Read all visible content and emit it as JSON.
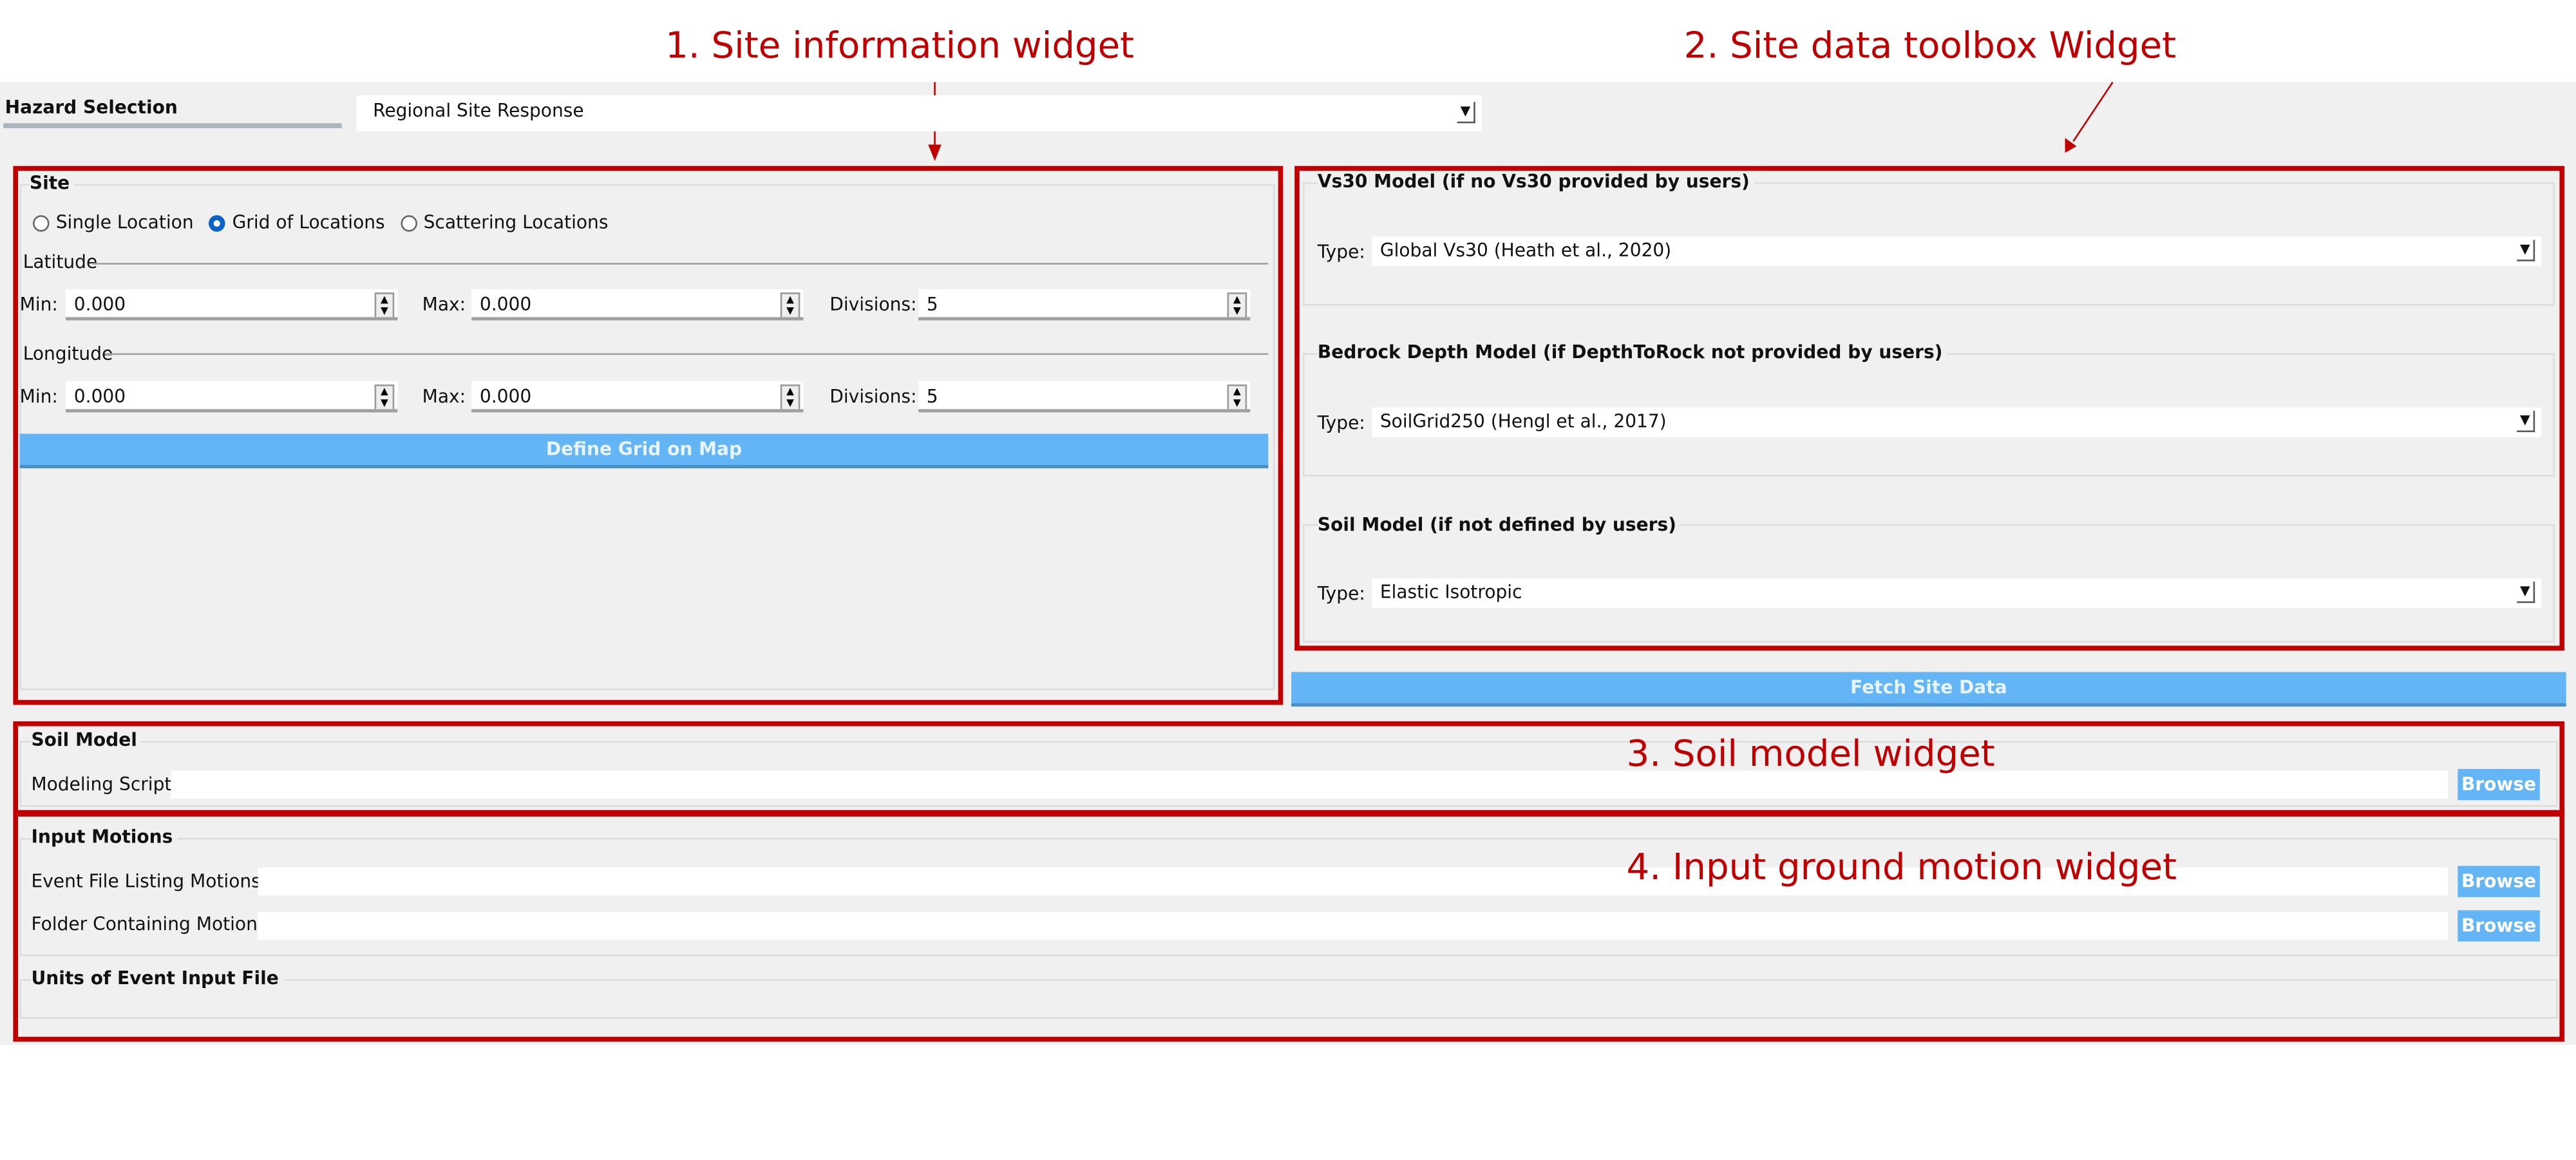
{
  "annotations": {
    "a1": "1. Site information widget",
    "a2": "2. Site data toolbox Widget",
    "a3": "3. Soil model widget",
    "a4": "4. Input ground motion widget",
    "color": "#c00000"
  },
  "hazard": {
    "label": "Hazard Selection",
    "value": "Regional Site Response"
  },
  "site": {
    "title": "Site",
    "radios": [
      {
        "label": "Single Location",
        "checked": false
      },
      {
        "label": "Grid of Locations",
        "checked": true
      },
      {
        "label": "Scattering Locations",
        "checked": false
      }
    ],
    "latitude": {
      "label": "Latitude",
      "min_label": "Min:",
      "min": "0.000",
      "max_label": "Max:",
      "max": "0.000",
      "div_label": "Divisions:",
      "divisions": "5"
    },
    "longitude": {
      "label": "Longitude",
      "min_label": "Min:",
      "min": "0.000",
      "max_label": "Max:",
      "max": "0.000",
      "div_label": "Divisions:",
      "divisions": "5"
    },
    "define_button": "Define Grid on Map"
  },
  "toolbox": {
    "vs30": {
      "title": "Vs30 Model (if no Vs30 provided by users)",
      "type_label": "Type:",
      "value": "Global Vs30 (Heath et al., 2020)"
    },
    "bedrock": {
      "title": "Bedrock Depth Model (if DepthToRock not provided by users)",
      "type_label": "Type:",
      "value": "SoilGrid250 (Hengl et al., 2017)"
    },
    "soil": {
      "title": "Soil Model (if not defined by users)",
      "type_label": "Type:",
      "value": "Elastic Isotropic"
    },
    "fetch_button": "Fetch Site Data"
  },
  "soil_model": {
    "title": "Soil Model",
    "script_label": "Modeling Script",
    "script_value": "",
    "browse": "Browse"
  },
  "input_motions": {
    "title": "Input Motions",
    "event_label": "Event File Listing Motions",
    "event_value": "",
    "folder_label": "Folder Containing Motions",
    "folder_value": "",
    "browse": "Browse",
    "units_title": "Units of Event Input File"
  },
  "accent_color": "#64b5f6"
}
